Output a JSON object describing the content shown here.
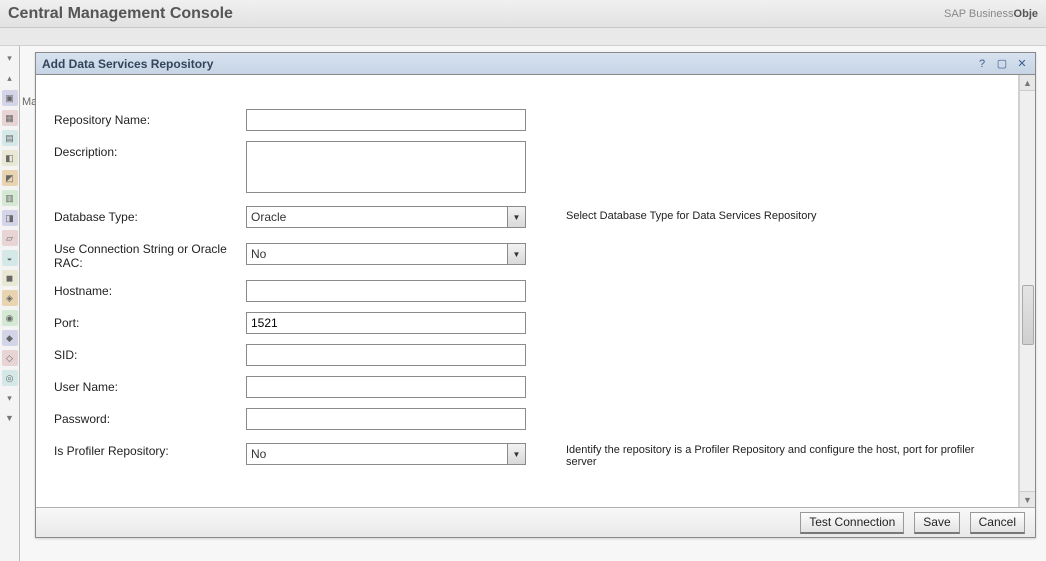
{
  "app": {
    "title": "Central Management Console"
  },
  "brand": {
    "prefix": "SAP Business",
    "bold": "Obje"
  },
  "sidebar": {
    "glyphs": [
      "▾",
      "▴",
      "▣",
      "▦",
      "▤",
      "◧",
      "◩",
      "▥",
      "◨",
      "▱",
      "◒",
      "◼",
      "◈",
      "◉",
      "◆",
      "◇",
      "◎",
      "▾",
      "▼"
    ]
  },
  "dialog": {
    "title": "Add Data Services Repository",
    "form": {
      "repo_name": {
        "label": "Repository Name:",
        "value": ""
      },
      "description": {
        "label": "Description:",
        "value": ""
      },
      "db_type": {
        "label": "Database Type:",
        "selected": "Oracle",
        "hint": "Select Database Type for Data Services Repository"
      },
      "use_conn_string": {
        "label": "Use Connection String or Oracle RAC:",
        "selected": "No"
      },
      "hostname": {
        "label": "Hostname:",
        "value": ""
      },
      "port": {
        "label": "Port:",
        "value": "1521"
      },
      "sid": {
        "label": "SID:",
        "value": ""
      },
      "user_name": {
        "label": "User Name:",
        "value": ""
      },
      "password": {
        "label": "Password:",
        "value": ""
      },
      "is_profiler": {
        "label": "Is Profiler Repository:",
        "selected": "No",
        "hint": "Identify the repository is a Profiler Repository and configure the host, port for profiler server"
      }
    },
    "buttons": {
      "test": "Test Connection",
      "save": "Save",
      "cancel": "Cancel"
    },
    "titlebar_icons": {
      "help": "?",
      "max": "▢",
      "close": "✕"
    }
  },
  "stub_label": "Ma"
}
